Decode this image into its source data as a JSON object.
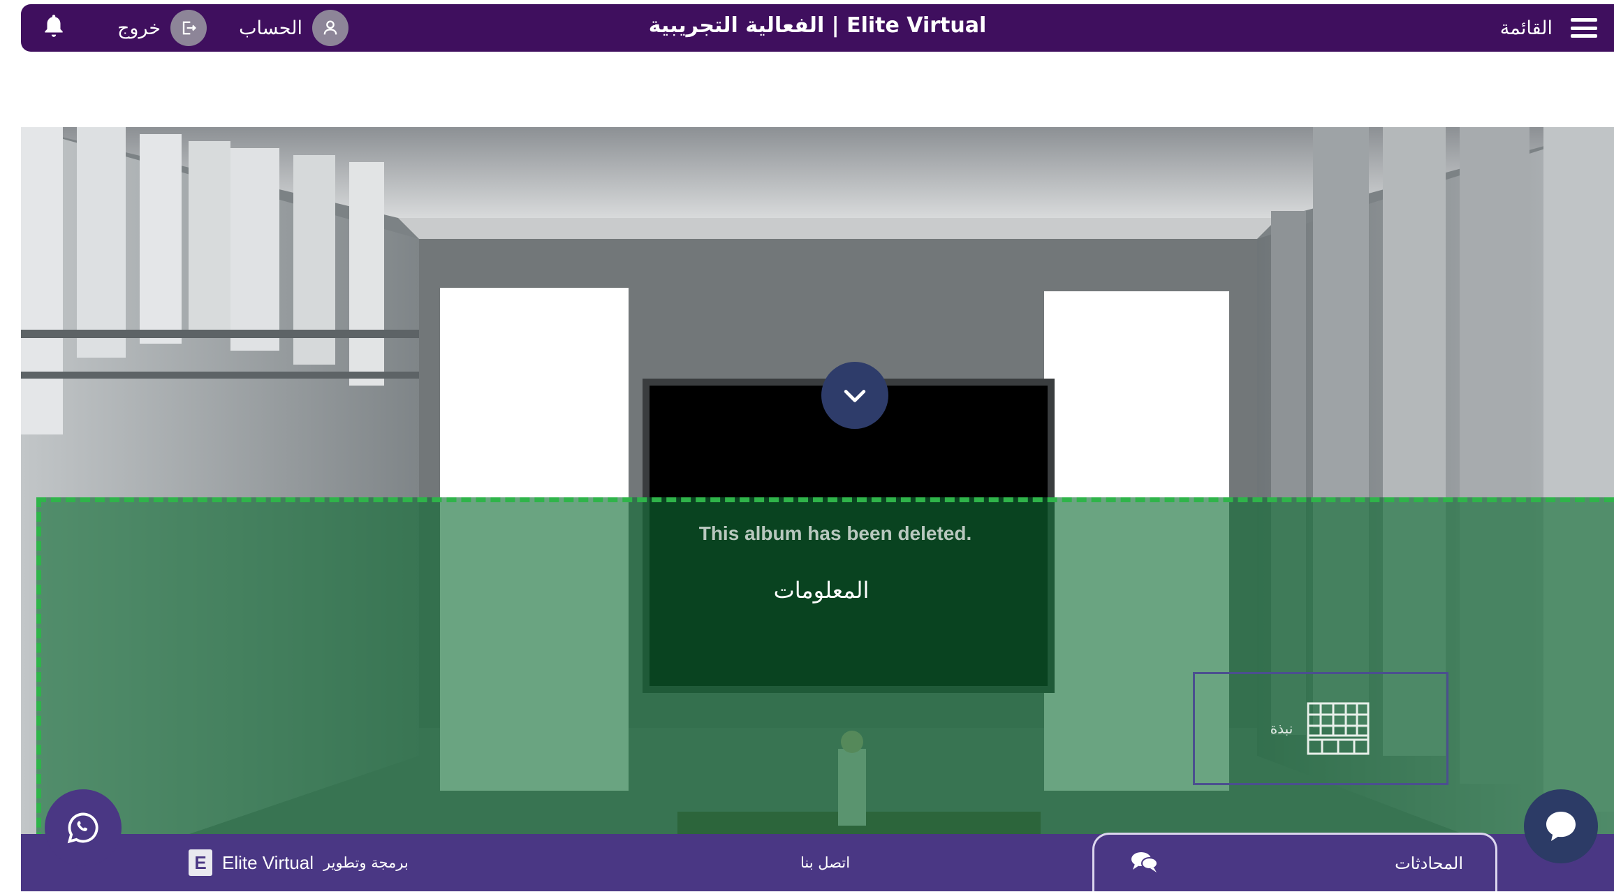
{
  "header": {
    "title": "الفعالية التجريبية | Elite Virtual",
    "menu_label": "القائمة",
    "account_label": "الحساب",
    "logout_label": "خروج"
  },
  "stage": {
    "deleted_message": "This album has been deleted.",
    "info_label": "المعلومات",
    "booth_label": "نبذة"
  },
  "footer": {
    "credit_prefix": "برمجة وتطوير",
    "brand_name": "Elite Virtual",
    "contact_label": "اتصل بنا",
    "chats_label": "المحادثات"
  },
  "icons": {
    "bell": "bell-icon",
    "logout": "logout-icon",
    "user": "user-icon",
    "menu": "hamburger-icon",
    "collapse": "chevron-down-icon",
    "booth": "building-icon",
    "whatsapp": "whatsapp-icon",
    "chats": "chat-bubbles-icon",
    "chat_fab": "speech-bubble-icon"
  },
  "colors": {
    "header_bg": "#3f0f5e",
    "footer_bg": "#4a3784",
    "overlay": "#0e6c34",
    "dash": "#2fb44a"
  }
}
